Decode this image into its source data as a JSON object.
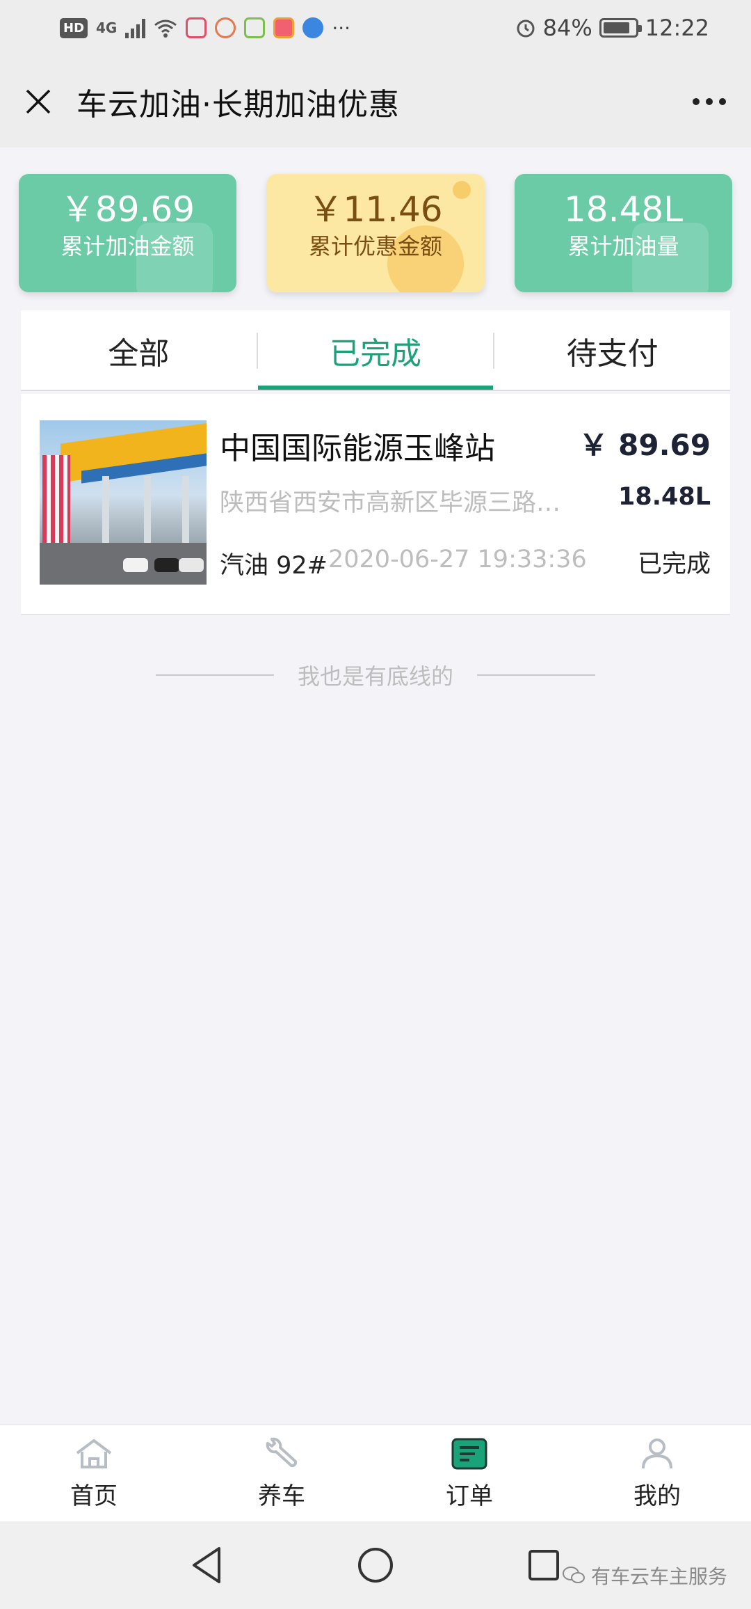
{
  "status_bar": {
    "hd": "HD",
    "network": "4G",
    "more": "···",
    "battery": "84%",
    "time": "12:22"
  },
  "header": {
    "title": "车云加油·长期加油优惠"
  },
  "stats": [
    {
      "value": "￥89.69",
      "label": "累计加油金额",
      "style": "green"
    },
    {
      "value": "￥11.46",
      "label": "累计优惠金额",
      "style": "yellow"
    },
    {
      "value": "18.48L",
      "label": "累计加油量",
      "style": "green"
    }
  ],
  "tabs": [
    {
      "label": "全部"
    },
    {
      "label": "已完成"
    },
    {
      "label": "待支付"
    }
  ],
  "orders": [
    {
      "station": "中国国际能源玉峰站",
      "amount": "￥ 89.69",
      "address": "陕西省西安市高新区毕源三路西...",
      "volume": "18.48L",
      "fuel": "汽油 92#",
      "datetime": "2020-06-27 19:33:36",
      "status": "已完成"
    }
  ],
  "end_text": "我也是有底线的",
  "bottom_nav": [
    {
      "label": "首页",
      "icon": "home-icon"
    },
    {
      "label": "养车",
      "icon": "wrench-icon"
    },
    {
      "label": "订单",
      "icon": "order-icon"
    },
    {
      "label": "我的",
      "icon": "user-icon"
    }
  ],
  "watermark": "有车云车主服务",
  "colors": {
    "accent": "#1aa379",
    "card_green": "#6bcba7",
    "card_yellow": "#fde8a3"
  }
}
